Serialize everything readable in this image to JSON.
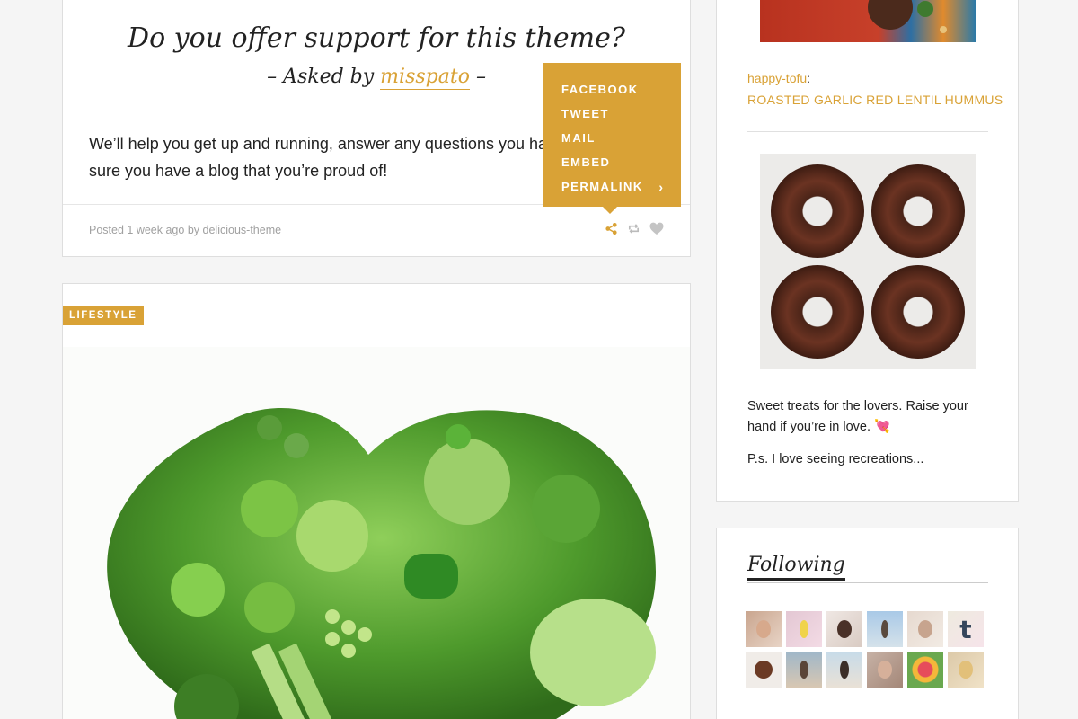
{
  "ask_post": {
    "question": "Do you offer support for this theme?",
    "byline_prefix": "– Asked by",
    "asker": "misspato",
    "byline_suffix": "–",
    "answer": "We’ll help you get up and running, answer any questions you have and make sure you have a blog that you’re proud of!",
    "meta_prefix": "Posted",
    "meta_time": "1 week ago",
    "meta_by": "by",
    "meta_author": "delicious-theme"
  },
  "share_menu": {
    "items": [
      "FACEBOOK",
      "TWEET",
      "MAIL",
      "EMBED",
      "PERMALINK"
    ]
  },
  "photo_post": {
    "tag": "LIFESTYLE"
  },
  "sidebar": {
    "reblog_user": "happy-tofu",
    "reblog_colon": ":",
    "reblog_title": "ROASTED GARLIC RED LENTIL HUMMUS",
    "post_text": "Sweet treats for the lovers. Raise your hand if you’re in love. 💘",
    "post_text_2": "P.s. I love seeing recreations...",
    "following_title": "Following"
  },
  "colors": {
    "accent": "#d9a236",
    "background": "#f5f5f5",
    "card": "#ffffff",
    "text": "#222222",
    "muted": "#a0a0a0"
  }
}
